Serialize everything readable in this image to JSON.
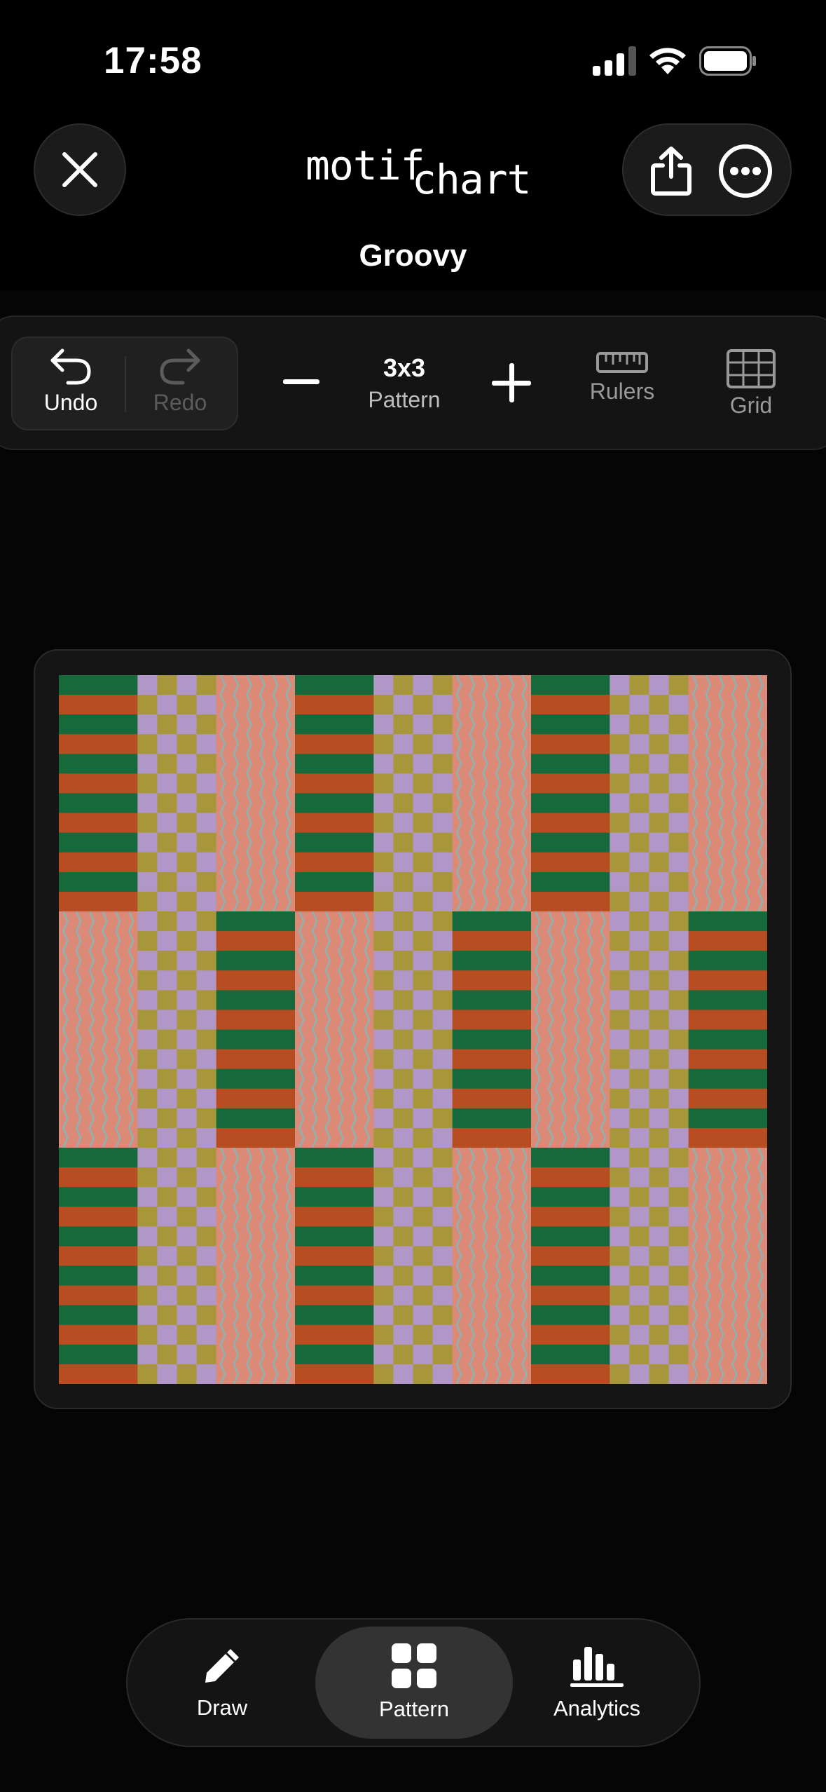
{
  "status_bar": {
    "time": "17:58"
  },
  "header": {
    "logo_part1": "motif",
    "logo_part2": "chart",
    "document_title": "Groovy"
  },
  "toolbar": {
    "undo_label": "Undo",
    "redo_label": "Redo",
    "pattern_size": "3x3",
    "pattern_label": "Pattern",
    "rulers_label": "Rulers",
    "grid_label": "Grid"
  },
  "pattern": {
    "grid": [
      [
        "stripes",
        "checks",
        "waves",
        "stripes",
        "checks",
        "waves",
        "stripes",
        "checks",
        "waves"
      ],
      [
        "waves",
        "checks",
        "stripes",
        "waves",
        "checks",
        "stripes",
        "waves",
        "checks",
        "stripes"
      ],
      [
        "stripes",
        "checks",
        "waves",
        "stripes",
        "checks",
        "waves",
        "stripes",
        "checks",
        "waves"
      ]
    ],
    "colors": {
      "green": "#15693b",
      "orange": "#b94d22",
      "lavender": "#b197c8",
      "olive": "#a7973a",
      "salmon": "#db8a78",
      "teal": "#8ab3b3"
    }
  },
  "tabbar": {
    "draw_label": "Draw",
    "pattern_label": "Pattern",
    "analytics_label": "Analytics",
    "active_tab": "Pattern"
  }
}
